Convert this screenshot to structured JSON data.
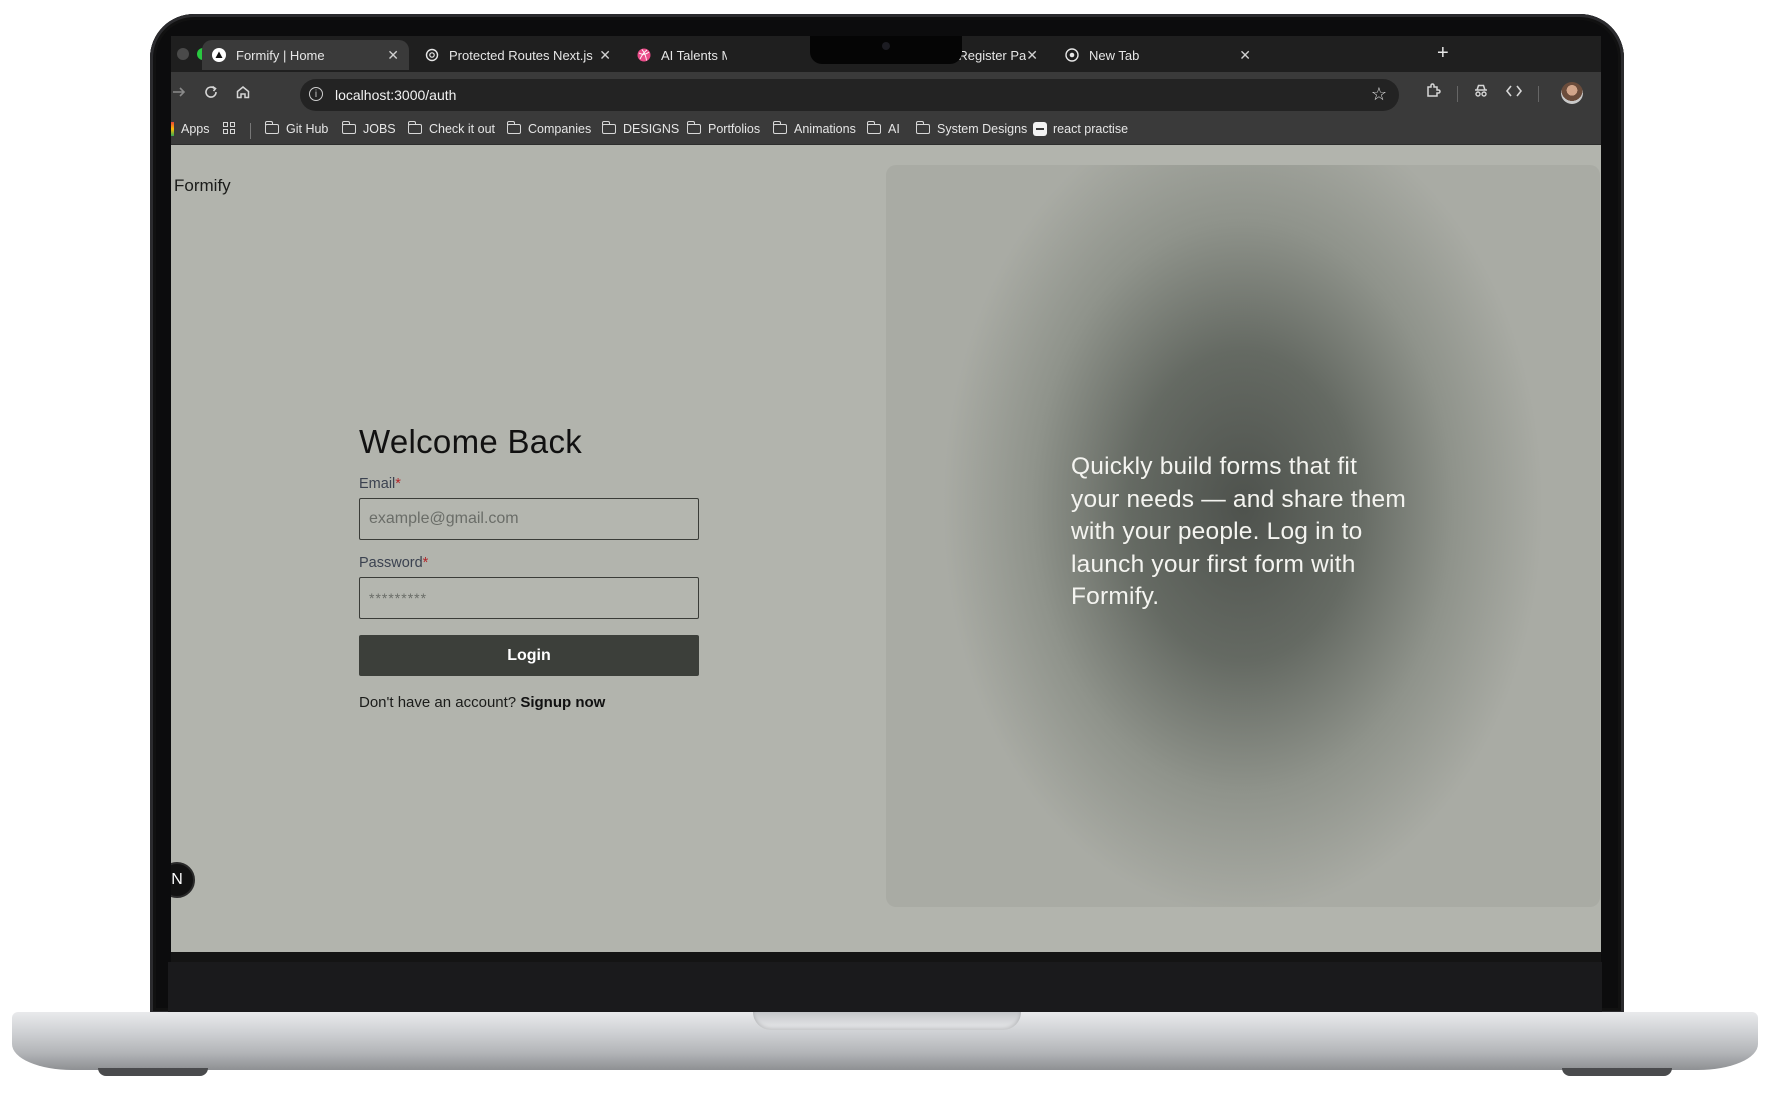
{
  "browser": {
    "tabs": [
      {
        "title": "Formify | Home",
        "icon": "triangle-icon",
        "active": true
      },
      {
        "title": "Protected Routes Next.js",
        "icon": "openai-icon",
        "active": false
      },
      {
        "title": "AI Talents Mc",
        "icon": "dribbble-icon",
        "active": false
      },
      {
        "title": "HR Platform - Register Page b",
        "icon": "dribbble-icon",
        "active": false
      },
      {
        "title": "New Tab",
        "icon": "chrome-icon",
        "active": false
      }
    ],
    "close_glyph": "✕",
    "new_tab_glyph": "+",
    "url": "localhost:3000/auth",
    "bookmarks": {
      "apps": "Apps",
      "items": [
        "Git Hub",
        "JOBS",
        "Check it out",
        "Companies",
        "DESIGNS",
        "Portfolios",
        "Animations",
        "AI",
        "System Designs"
      ],
      "react": "react practise"
    }
  },
  "page": {
    "brand": "Formify",
    "heading": "Welcome Back",
    "email": {
      "label": "Email",
      "required_mark": "*",
      "placeholder": "example@gmail.com"
    },
    "password": {
      "label": "Password",
      "required_mark": "*",
      "placeholder": "*********"
    },
    "login_button": "Login",
    "signup_prompt": "Don't have an account?",
    "signup_link": "Signup now",
    "hero_text": "Quickly build forms that fit your needs — and share them with your people. Log in to launch your first form with Formify.",
    "dev_badge": "N"
  },
  "colors": {
    "page_bg": "#b2b4ad",
    "button_bg": "#3c3f3a",
    "required": "#b3262a"
  }
}
